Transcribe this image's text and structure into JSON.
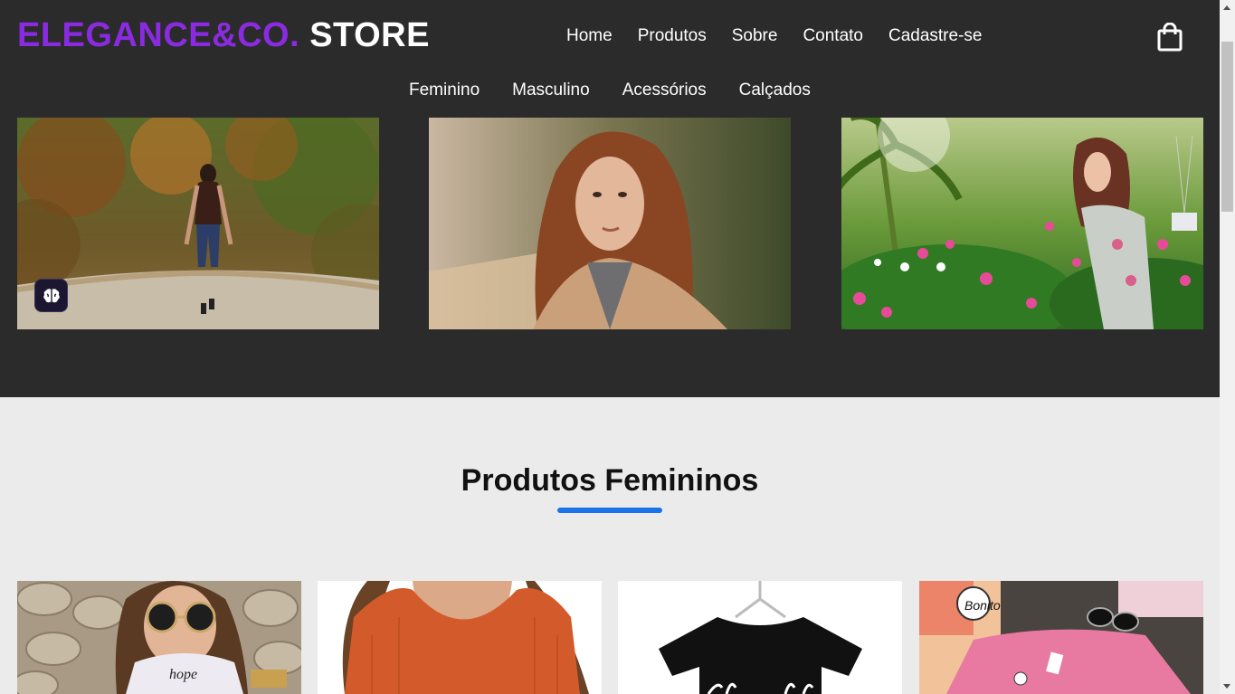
{
  "brand": {
    "part1": "ELEGANCE&CO.",
    "part2": "STORE",
    "accent_color": "#8a2be2"
  },
  "main_nav": [
    "Home",
    "Produtos",
    "Sobre",
    "Contato",
    "Cadastre-se"
  ],
  "cart": {
    "icon": "shopping-bag-icon"
  },
  "category_nav": [
    "Feminino",
    "Masculino",
    "Acessórios",
    "Calçados"
  ],
  "hero_images": [
    {
      "icon": "photo-woman-walking-forest-path"
    },
    {
      "icon": "photo-woman-portrait-red-hair"
    },
    {
      "icon": "photo-woman-flower-garden"
    }
  ],
  "extension_badge": {
    "icon": "brain-icon"
  },
  "section": {
    "title": "Produtos Femininos",
    "underline_color": "#1a73e8"
  },
  "products": [
    {
      "icon": "photo-white-top-sunglasses",
      "print_text": "hope"
    },
    {
      "icon": "photo-orange-ribbed-top"
    },
    {
      "icon": "photo-black-tshirt-hanger"
    },
    {
      "icon": "photo-pink-tshirt-flatlay",
      "print_text": "Bonito"
    }
  ],
  "colors": {
    "header_bg": "#2b2b2b",
    "page_bg": "#ebebeb"
  }
}
